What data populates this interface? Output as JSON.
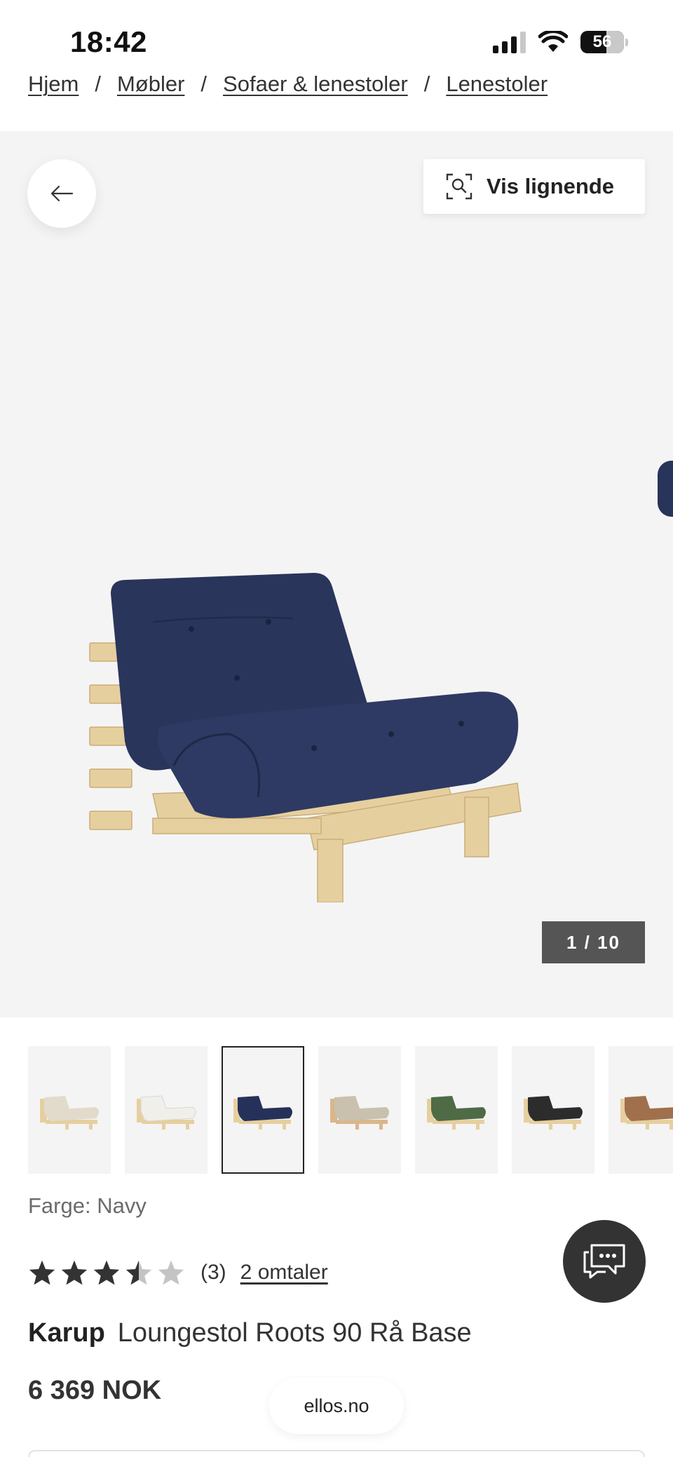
{
  "status_bar": {
    "time": "18:42",
    "battery": "56"
  },
  "breadcrumb": [
    "Hjem",
    "Møbler",
    "Sofaer & lenestoler",
    "Lenestoler"
  ],
  "gallery": {
    "similar_label": "Vis lignende",
    "counter": "1 / 10",
    "background": "#f4f4f4"
  },
  "thumbnails": [
    {
      "color": "#e2dbcc",
      "selected": false
    },
    {
      "color": "#f0efea",
      "selected": false
    },
    {
      "color": "#26315a",
      "selected": true
    },
    {
      "color": "#c9c0ae",
      "selected": false
    },
    {
      "color": "#4f6b45",
      "selected": false
    },
    {
      "color": "#2c2c2c",
      "selected": false
    },
    {
      "color": "#a0704d",
      "selected": false
    }
  ],
  "product": {
    "color_label": "Farge: Navy",
    "rating_value": 3.5,
    "rating_max": 5,
    "rating_count": "(3)",
    "reviews_link": "2 omtaler",
    "brand": "Karup",
    "name": "Loungestol Roots 90 Rå Base",
    "price": "6 369 NOK"
  },
  "footer": {
    "domain": "ellos.no"
  },
  "colors": {
    "cushion_navy": "#2a355c",
    "wood": "#e6cf9f",
    "counter_bg": "#555555",
    "chat_bg": "#333333"
  }
}
